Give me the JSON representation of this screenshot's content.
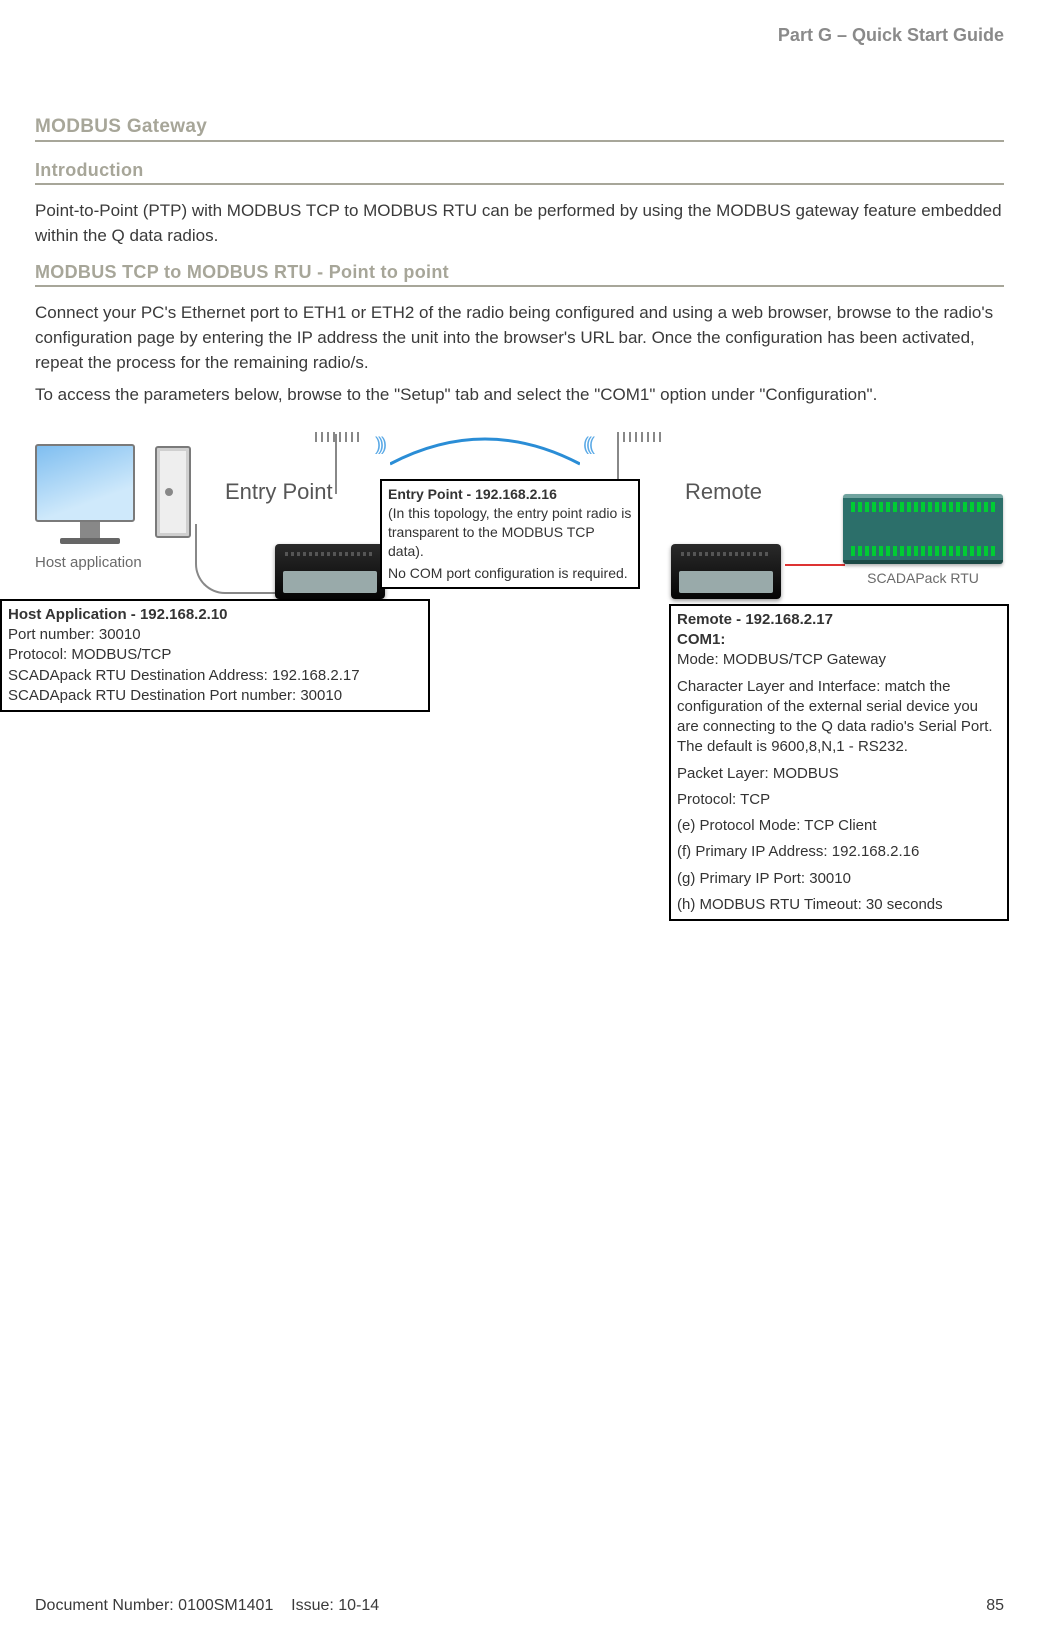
{
  "header": {
    "part": "Part G – Quick Start Guide"
  },
  "headings": {
    "h1": "MODBUS Gateway",
    "h2": "Introduction",
    "h3": "MODBUS TCP to MODBUS RTU - Point to point"
  },
  "paragraphs": {
    "intro": "Point-to-Point (PTP) with MODBUS TCP to MODBUS RTU can be performed by using the MODBUS gateway feature embedded within the Q data radios.",
    "connect": "Connect your PC's Ethernet port to ETH1 or ETH2 of the radio being configured and using a web browser, browse to the radio's configuration page by entering the IP address the unit into the browser's URL bar.  Once the configuration has been activated, repeat the process for the remaining radio/s.",
    "access": "To access the parameters below, browse to the \"Setup\" tab and select the \"COM1\" option under \"Configuration\"."
  },
  "diagram": {
    "host_label": "Host application",
    "entry_point_label": "Entry Point",
    "remote_label": "Remote",
    "rtu_label": "SCADAPack RTU",
    "entry_callout": {
      "title": "Entry Point - 192.168.2.16",
      "line1": "(In this topology, the entry point radio is transparent to the MODBUS TCP data).",
      "line2": "No COM port configuration is required."
    },
    "host_callout": {
      "title": "Host Application - 192.168.2.10",
      "l1": "Port number: 30010",
      "l2": "Protocol: MODBUS/TCP",
      "l3": "SCADApack RTU Destination Address: 192.168.2.17",
      "l4": "SCADApack RTU Destination Port number: 30010"
    },
    "remote_callout": {
      "title": "Remote - 192.168.2.17",
      "com": "COM1:",
      "l1": "Mode: MODBUS/TCP Gateway",
      "l2": "Character Layer and Interface: match the configuration of the external serial device you are connecting to the Q data radio's Serial Port. The default is 9600,8,N,1 - RS232.",
      "l3": "Packet Layer: MODBUS",
      "l4": "Protocol: TCP",
      "l5": "(e) Protocol Mode: TCP Client",
      "l6": "(f) Primary IP Address: 192.168.2.16",
      "l7": "(g) Primary IP Port: 30010",
      "l8": "(h) MODBUS RTU Timeout: 30 seconds"
    }
  },
  "footer": {
    "doc": "Document Number: 0100SM1401",
    "issue": "Issue: 10-14",
    "page": "85"
  }
}
